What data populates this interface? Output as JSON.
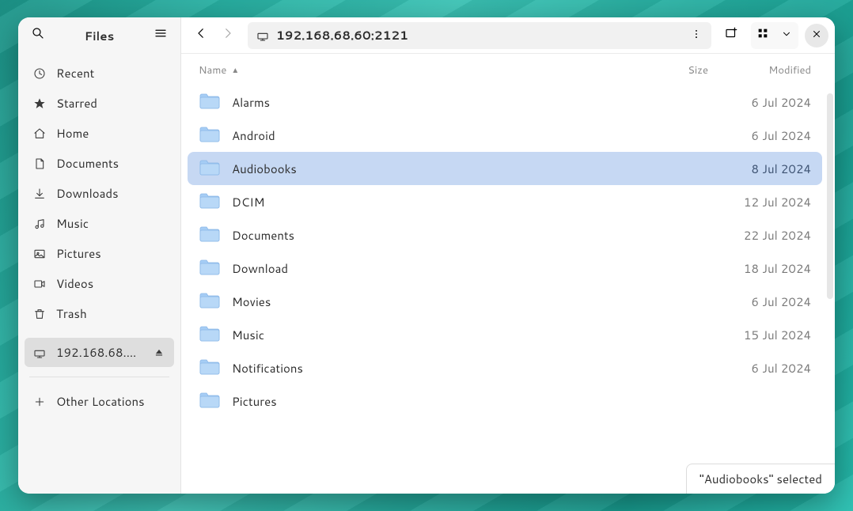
{
  "app": {
    "title": "Files"
  },
  "toolbar": {
    "path": "192.168.68.60:2121"
  },
  "columns": {
    "name": "Name",
    "size": "Size",
    "modified": "Modified"
  },
  "sortIndicator": "▲",
  "sidebar": {
    "items": [
      {
        "label": "Recent"
      },
      {
        "label": "Starred"
      },
      {
        "label": "Home"
      },
      {
        "label": "Documents"
      },
      {
        "label": "Downloads"
      },
      {
        "label": "Music"
      },
      {
        "label": "Pictures"
      },
      {
        "label": "Videos"
      },
      {
        "label": "Trash"
      }
    ],
    "network": {
      "label": "192.168.68.6…"
    },
    "other": {
      "label": "Other Locations"
    }
  },
  "files": [
    {
      "name": "Alarms",
      "size": "",
      "modified": "6 Jul 2024"
    },
    {
      "name": "Android",
      "size": "",
      "modified": "6 Jul 2024"
    },
    {
      "name": "Audiobooks",
      "size": "",
      "modified": "8 Jul 2024"
    },
    {
      "name": "DCIM",
      "size": "",
      "modified": "12 Jul 2024"
    },
    {
      "name": "Documents",
      "size": "",
      "modified": "22 Jul 2024"
    },
    {
      "name": "Download",
      "size": "",
      "modified": "18 Jul 2024"
    },
    {
      "name": "Movies",
      "size": "",
      "modified": "6 Jul 2024"
    },
    {
      "name": "Music",
      "size": "",
      "modified": "15 Jul 2024"
    },
    {
      "name": "Notifications",
      "size": "",
      "modified": "6 Jul 2024"
    },
    {
      "name": "Pictures",
      "size": "",
      "modified": ""
    }
  ],
  "selectedIndex": 2,
  "status": "\"Audiobooks\" selected"
}
